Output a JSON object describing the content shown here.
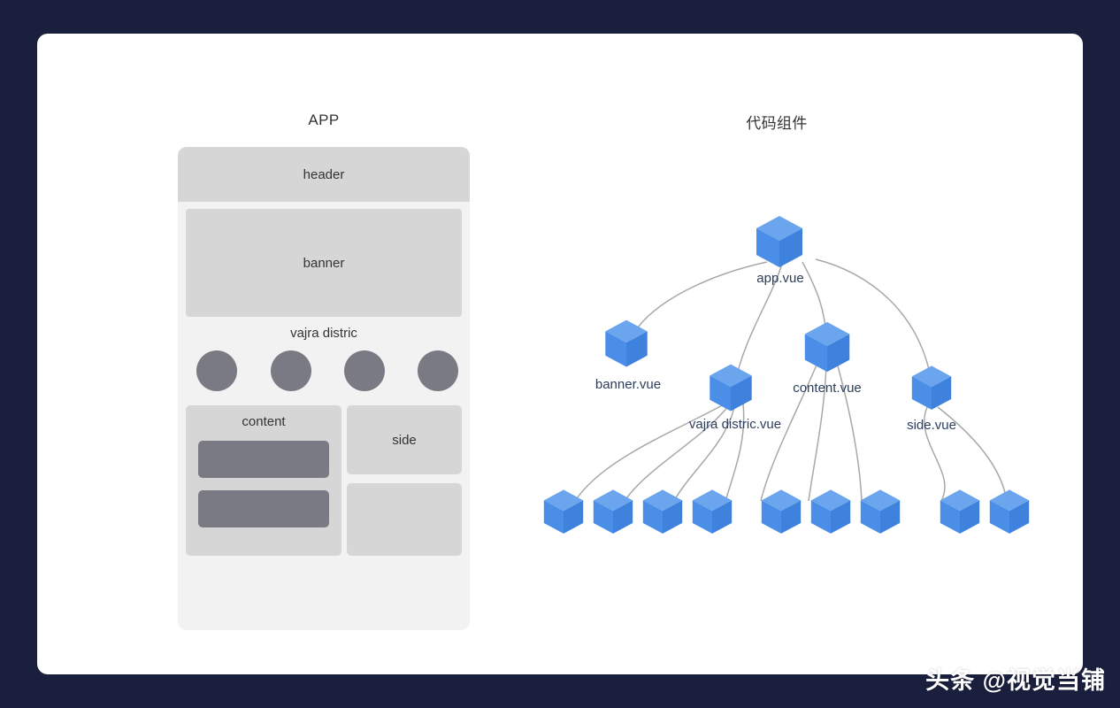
{
  "background": {
    "page_color": "#1a1f3d",
    "card_color": "#ffffff"
  },
  "panels": {
    "left": {
      "title": "APP",
      "blocks": {
        "header": "header",
        "banner": "banner",
        "vajra": "vajra distric",
        "content": "content",
        "side": "side",
        "side_secondary": ""
      },
      "circle_count": 4,
      "content_bar_count": 2,
      "colors": {
        "phone_bg": "#f2f2f2",
        "block": "#d6d6d6",
        "accent_gray": "#7a7a84"
      }
    },
    "right": {
      "title": "代码组件",
      "colors": {
        "cube_front": "#4a8ee8",
        "cube_top": "#6ba5ed",
        "cube_side": "#3f82dd",
        "link": "#a8a8a8",
        "label": "#2c3e5c"
      }
    }
  },
  "tree": {
    "root": {
      "label": "app.vue"
    },
    "children": [
      {
        "label": "banner.vue"
      },
      {
        "label": "vajra distric.vue"
      },
      {
        "label": "content.vue"
      },
      {
        "label": "side.vue"
      }
    ],
    "leaf_groups": [
      {
        "parent": "vajra distric.vue",
        "count": 4
      },
      {
        "parent": "content.vue",
        "count": 3
      },
      {
        "parent": "side.vue",
        "count": 2
      }
    ],
    "leaf_total": 9
  },
  "watermark": {
    "text": "头条 @视觉当铺"
  }
}
